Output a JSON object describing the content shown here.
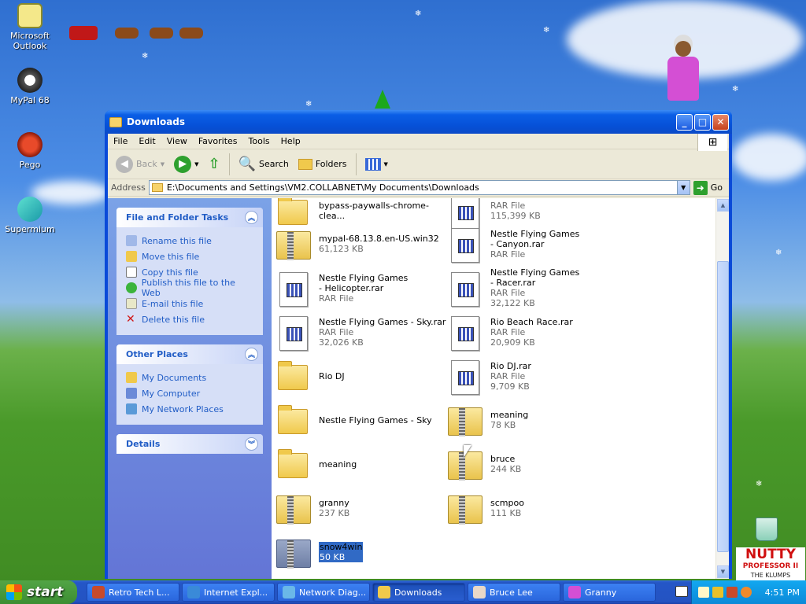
{
  "desktop": {
    "icons": [
      {
        "label": "Microsoft Outlook",
        "icon": "outlook-icon"
      },
      {
        "label": "MyPal 68",
        "icon": "mypal-icon"
      },
      {
        "label": "Pego",
        "icon": "pego-icon"
      },
      {
        "label": "Supermium",
        "icon": "supermium-icon"
      }
    ],
    "ad_title": "NUTTY",
    "ad_sub1": "PROFESSOR II",
    "ad_sub2": "THE KLUMPS"
  },
  "window": {
    "title": "Downloads",
    "menu": [
      "File",
      "Edit",
      "View",
      "Favorites",
      "Tools",
      "Help"
    ],
    "toolbar": {
      "back": "Back",
      "search": "Search",
      "folders": "Folders"
    },
    "address": {
      "label": "Address",
      "value": "E:\\Documents and Settings\\VM2.COLLABNET\\My Documents\\Downloads",
      "go": "Go"
    }
  },
  "sidebar": {
    "file_tasks": {
      "title": "File and Folder Tasks",
      "items": [
        "Rename this file",
        "Move this file",
        "Copy this file",
        "Publish this file to the Web",
        "E-mail this file",
        "Delete this file"
      ]
    },
    "other_places": {
      "title": "Other Places",
      "items": [
        "My Documents",
        "My Computer",
        "My Network Places"
      ]
    },
    "details": {
      "title": "Details"
    }
  },
  "files": [
    {
      "name": "bypass-paywalls-chrome-clea...",
      "type": "",
      "size": "",
      "kind": "folder"
    },
    {
      "name": "",
      "type": "RAR File",
      "size": "115,399 KB",
      "kind": "rar"
    },
    {
      "name": "mypal-68.13.8.en-US.win32",
      "type": "",
      "size": "61,123 KB",
      "kind": "zip"
    },
    {
      "name": "Nestle Flying Games - Canyon.rar",
      "type": "RAR File",
      "size": "",
      "kind": "rar"
    },
    {
      "name": "Nestle Flying Games - Helicopter.rar",
      "type": "RAR File",
      "size": "",
      "kind": "rar"
    },
    {
      "name": "Nestle Flying Games - Racer.rar",
      "type": "RAR File",
      "size": "32,122 KB",
      "kind": "rar"
    },
    {
      "name": "Nestle Flying Games - Sky.rar",
      "type": "RAR File",
      "size": "32,026 KB",
      "kind": "rar"
    },
    {
      "name": "Rio Beach Race.rar",
      "type": "RAR File",
      "size": "20,909 KB",
      "kind": "rar"
    },
    {
      "name": "Rio DJ",
      "type": "",
      "size": "",
      "kind": "folder"
    },
    {
      "name": "Rio DJ.rar",
      "type": "RAR File",
      "size": "9,709 KB",
      "kind": "rar"
    },
    {
      "name": "Nestle Flying Games - Sky",
      "type": "",
      "size": "",
      "kind": "folder"
    },
    {
      "name": "meaning",
      "type": "",
      "size": "78 KB",
      "kind": "zip"
    },
    {
      "name": "meaning",
      "type": "",
      "size": "",
      "kind": "folder"
    },
    {
      "name": "bruce",
      "type": "",
      "size": "244 KB",
      "kind": "zip"
    },
    {
      "name": "granny",
      "type": "",
      "size": "237 KB",
      "kind": "zip"
    },
    {
      "name": "scmpoo",
      "type": "",
      "size": "111 KB",
      "kind": "zip"
    },
    {
      "name": "snow4win",
      "type": "",
      "size": "50 KB",
      "kind": "zip",
      "selected": true
    }
  ],
  "taskbar": {
    "start": "start",
    "tasks": [
      {
        "label": "Retro Tech L...",
        "icon": "film-icon",
        "active": false
      },
      {
        "label": "Internet Expl...",
        "icon": "ie-icon",
        "active": false
      },
      {
        "label": "Network Diag...",
        "icon": "network-icon",
        "active": false
      },
      {
        "label": "Downloads",
        "icon": "folder-icon",
        "active": true
      },
      {
        "label": "Bruce Lee",
        "icon": "bruce-icon",
        "active": false
      },
      {
        "label": "Granny",
        "icon": "granny-icon",
        "active": false
      }
    ],
    "clock": "4:51 PM"
  }
}
